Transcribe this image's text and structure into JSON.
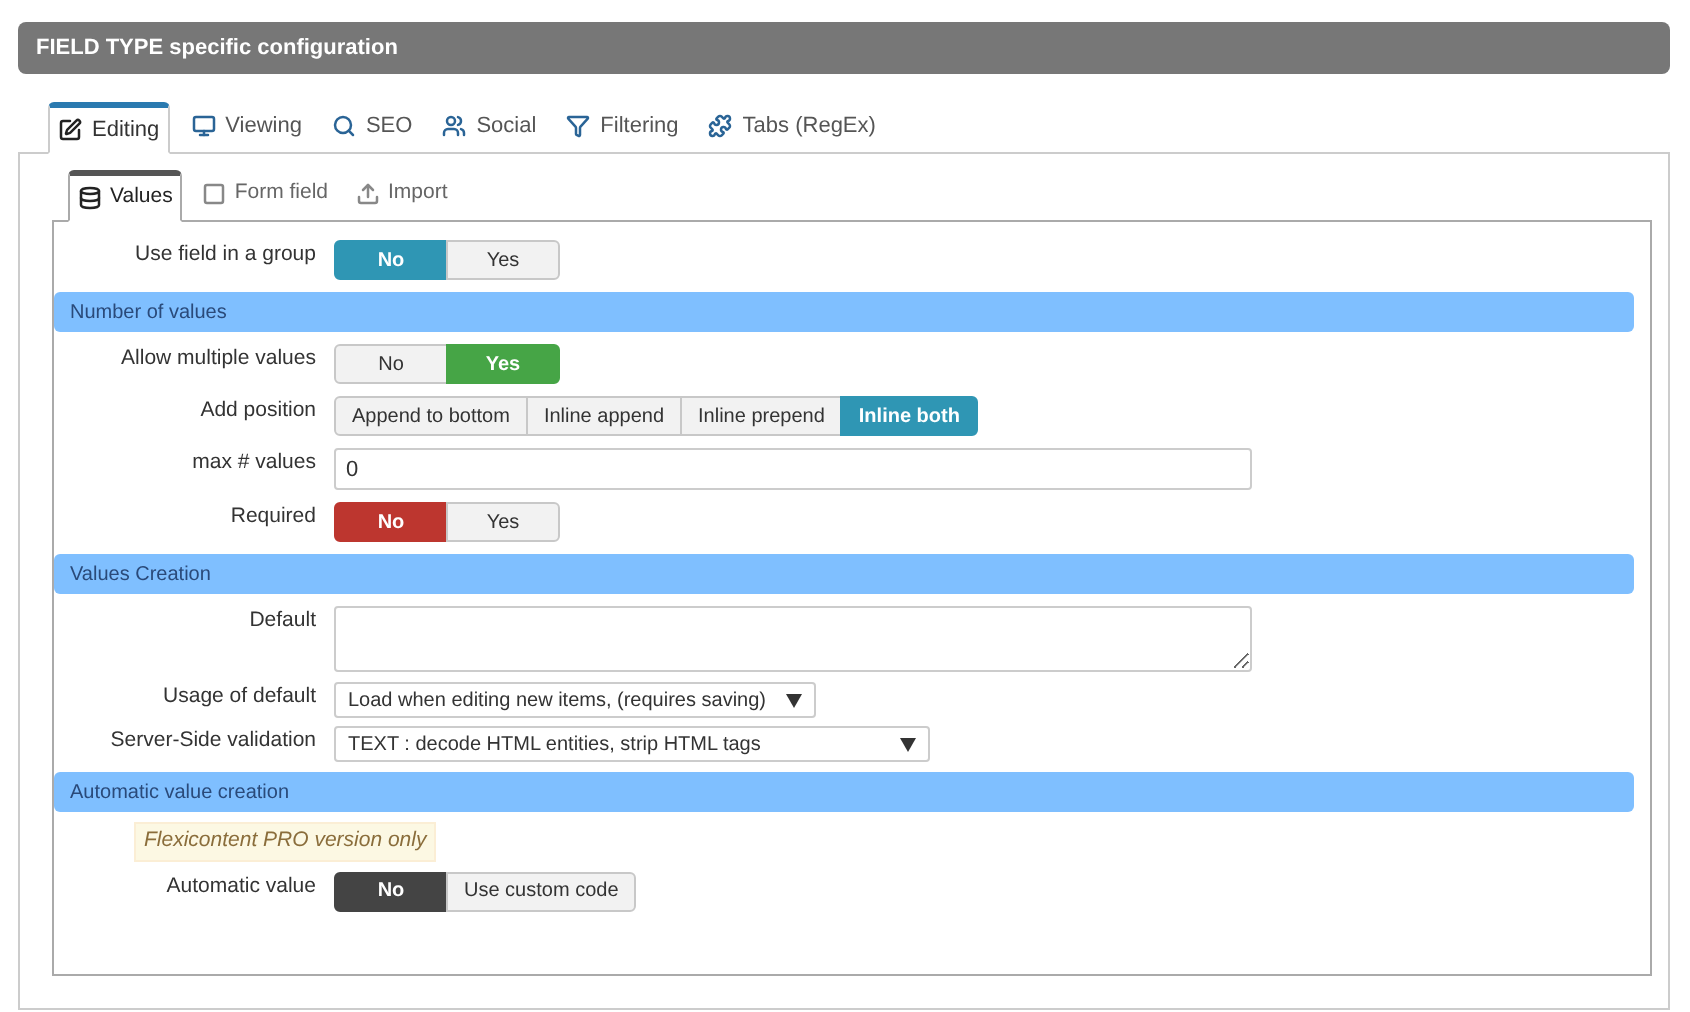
{
  "header": {
    "title": "FIELD TYPE specific configuration"
  },
  "tabs": [
    {
      "label": "Editing",
      "selected": true
    },
    {
      "label": "Viewing",
      "selected": false
    },
    {
      "label": "SEO",
      "selected": false
    },
    {
      "label": "Social",
      "selected": false
    },
    {
      "label": "Filtering",
      "selected": false
    },
    {
      "label": "Tabs (RegEx)",
      "selected": false
    }
  ],
  "subtabs": [
    {
      "label": "Values",
      "selected": true
    },
    {
      "label": "Form field",
      "selected": false
    },
    {
      "label": "Import",
      "selected": false
    }
  ],
  "rows": [
    {
      "kind": "toggle",
      "label": "Use field in a group",
      "color": "#2f96b4",
      "options": [
        {
          "label": "No",
          "selected": true
        },
        {
          "label": "Yes",
          "selected": false
        }
      ]
    },
    {
      "kind": "section",
      "label": "Number of values"
    },
    {
      "kind": "toggle",
      "label": "Allow multiple values",
      "color": "#46a546",
      "options": [
        {
          "label": "No",
          "selected": false
        },
        {
          "label": "Yes",
          "selected": true
        }
      ]
    },
    {
      "kind": "toggle",
      "label": "Add position",
      "color": "#2f96b4",
      "options": [
        {
          "label": "Append to bottom",
          "selected": false
        },
        {
          "label": "Inline append",
          "selected": false
        },
        {
          "label": "Inline prepend",
          "selected": false
        },
        {
          "label": "Inline both",
          "selected": true
        }
      ]
    },
    {
      "kind": "text",
      "label": "max # values",
      "value": "0"
    },
    {
      "kind": "toggle",
      "label": "Required",
      "color": "#bd362f",
      "options": [
        {
          "label": "No",
          "selected": true
        },
        {
          "label": "Yes",
          "selected": false
        }
      ]
    },
    {
      "kind": "section",
      "label": "Values Creation"
    },
    {
      "kind": "textarea",
      "label": "Default"
    },
    {
      "kind": "select",
      "label": "Usage of default",
      "value": "Load when editing new items, (requires saving)"
    },
    {
      "kind": "select",
      "label": "Server-Side validation",
      "value": "TEXT : decode HTML entities, strip HTML tags"
    },
    {
      "kind": "section",
      "label": "Automatic value creation"
    },
    {
      "kind": "note",
      "label": "Flexicontent PRO version only"
    },
    {
      "kind": "toggle",
      "label": "Automatic value",
      "color": "#444444",
      "options": [
        {
          "label": "No",
          "selected": true
        },
        {
          "label": "Use custom code",
          "selected": false
        }
      ]
    }
  ]
}
